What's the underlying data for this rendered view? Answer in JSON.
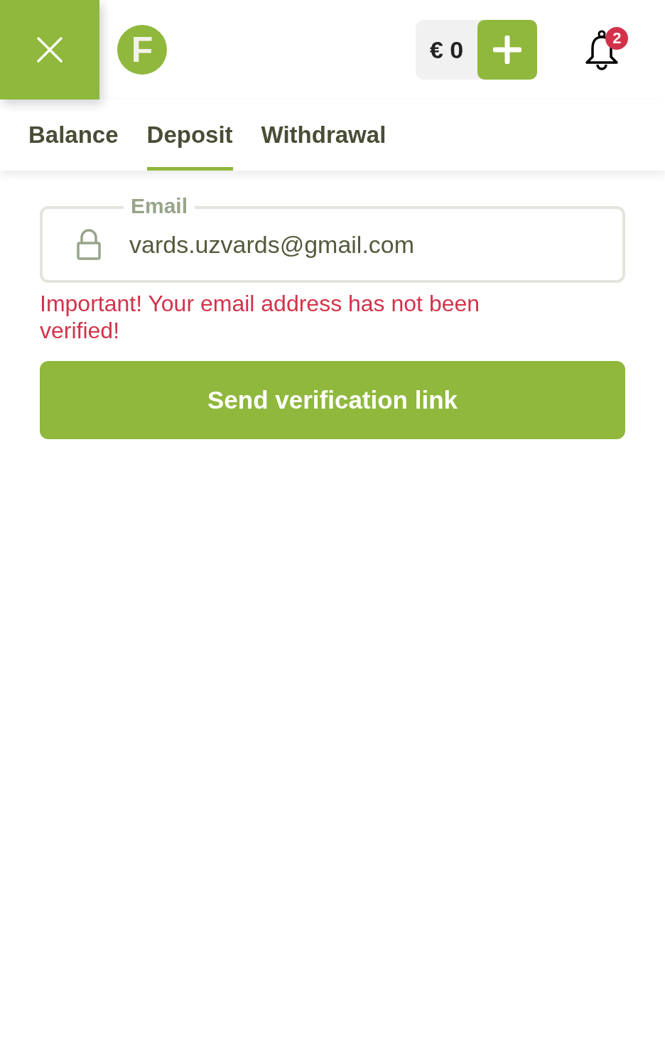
{
  "header": {
    "logo_letter": "F",
    "balance": "€ 0",
    "notifications": "2"
  },
  "tabs": [
    {
      "label": "Balance",
      "selected": false
    },
    {
      "label": "Deposit",
      "selected": true
    },
    {
      "label": "Withdrawal",
      "selected": false
    }
  ],
  "email_field": {
    "label": "Email",
    "value": "vards.uzvards@gmail.com",
    "locked": true
  },
  "warning": "Important! Your email address has not been verified!",
  "button": "Send verification link"
}
